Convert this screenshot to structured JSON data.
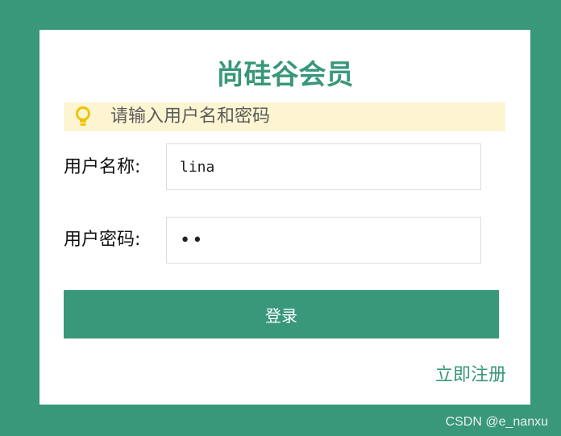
{
  "colors": {
    "background": "#39977a",
    "accent": "#39977a",
    "tip_background": "#fdf5d2",
    "tip_icon": "#f2c200"
  },
  "header": {
    "title": "尚硅谷会员"
  },
  "tip": {
    "icon": "lightbulb-icon",
    "text": "请输入用户名和密码"
  },
  "form": {
    "username_label": "用户名称:",
    "username_value": "lina",
    "password_label": "用户密码:",
    "password_value": "••",
    "login_label": "登录"
  },
  "links": {
    "register_label": "立即注册"
  },
  "watermark": "CSDN @e_nanxu"
}
